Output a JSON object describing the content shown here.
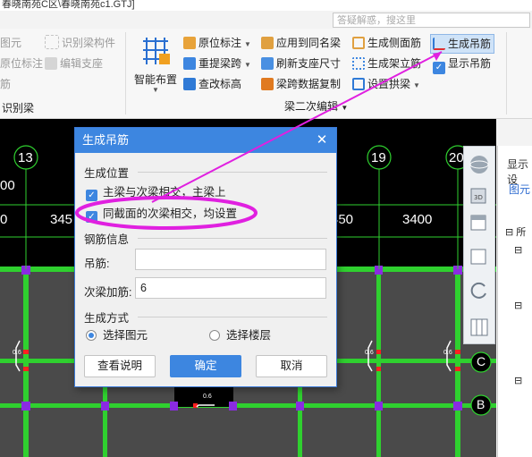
{
  "window": {
    "title": "春晓南苑C区\\春晓南苑c1.GTJ]"
  },
  "search": {
    "placeholder": "答疑解惑，搜这里"
  },
  "ribbon": {
    "left_items": [
      {
        "label": "图元",
        "disabled": true
      },
      {
        "label": "原位标注",
        "disabled": true
      },
      {
        "label": "筋",
        "disabled": true
      }
    ],
    "left_items2": [
      {
        "label": "识别梁构件",
        "disabled": true
      },
      {
        "label": "编辑支座",
        "disabled": true
      }
    ],
    "group_left_label": "识别梁",
    "smart_layout": {
      "label": "智能布置"
    },
    "col1": [
      {
        "label": "原位标注",
        "icon": "annotation-icon",
        "dropdown": true
      },
      {
        "label": "重提梁跨",
        "icon": "span-icon",
        "dropdown": true
      },
      {
        "label": "查改标高",
        "icon": "elevation-icon",
        "dropdown": false
      }
    ],
    "col2": [
      {
        "label": "应用到同名梁",
        "icon": "apply-icon",
        "dropdown": false
      },
      {
        "label": "刷新支座尺寸",
        "icon": "refresh-icon",
        "dropdown": false
      },
      {
        "label": "梁跨数据复制",
        "icon": "copy-icon",
        "dropdown": false
      }
    ],
    "col3": [
      {
        "label": "生成侧面筋",
        "icon": "side-rebar-icon",
        "dropdown": false
      },
      {
        "label": "生成架立筋",
        "icon": "erect-rebar-icon",
        "dropdown": false
      },
      {
        "label": "设置拱梁",
        "icon": "arch-icon",
        "dropdown": true
      }
    ],
    "col4": [
      {
        "label": "生成吊筋",
        "icon": "hanger-icon",
        "active": true
      },
      {
        "label": "显示吊筋",
        "icon": "checkbox-icon",
        "checked": true
      }
    ],
    "group_edit_label": "梁二次编辑"
  },
  "canvas": {
    "axis_labels": [
      "13",
      "19",
      "20"
    ],
    "row_labels": [
      "C",
      "B"
    ],
    "dims": [
      "00",
      "0",
      "345",
      "450",
      "3400"
    ],
    "small_labels": [
      "0.6",
      "0.6",
      "0.6",
      "0.6"
    ]
  },
  "right_panel": {
    "title": "显示设",
    "tab": "图元",
    "tree": [
      "所",
      "",
      "",
      ""
    ]
  },
  "dialog": {
    "title": "生成吊筋",
    "position_section": "生成位置",
    "option1": "主梁与次梁相交，主梁上",
    "option1_checked": true,
    "option2": "同截面的次梁相交，均设置",
    "option2_checked": true,
    "rebar_section": "钢筋信息",
    "hanger_label": "吊筋:",
    "hanger_value": "",
    "secondary_label": "次梁加筋:",
    "secondary_value": "6",
    "method_section": "生成方式",
    "radio1": "选择图元",
    "radio1_selected": true,
    "radio2": "选择楼层",
    "radio2_selected": false,
    "btn_help": "查看说明",
    "btn_ok": "确定",
    "btn_cancel": "取消"
  },
  "colors": {
    "accent": "#3d86e0",
    "grid_green": "#2fd02f",
    "column_purple": "#8a2be2",
    "annotation_magenta": "#e020e0"
  }
}
